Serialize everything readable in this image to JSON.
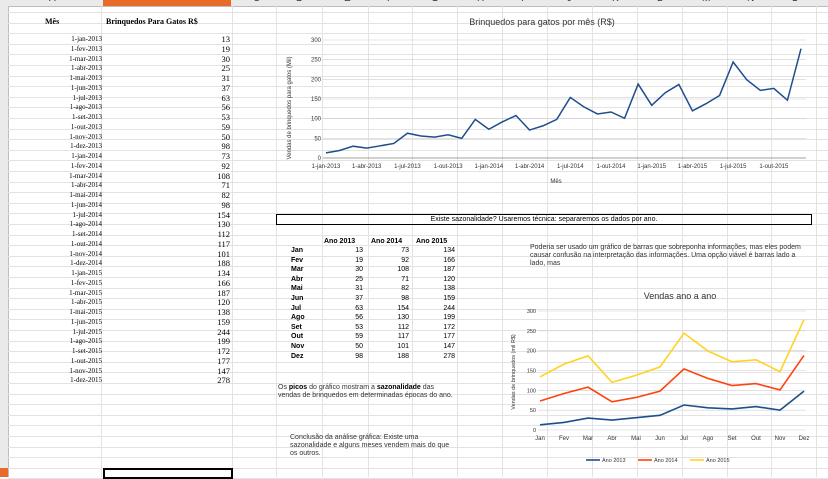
{
  "columns": [
    "A",
    "B",
    "C",
    "D",
    "E",
    "F",
    "G",
    "H",
    "I",
    "J",
    "K",
    "L",
    "M",
    "N",
    "O"
  ],
  "sheet": {
    "header_month": "Mês",
    "header_value": "Brinquedos Para Gatos R$",
    "rows": [
      {
        "date": "1-jan-2013",
        "value": "13"
      },
      {
        "date": "1-fev-2013",
        "value": "19"
      },
      {
        "date": "1-mar-2013",
        "value": "30"
      },
      {
        "date": "1-abr-2013",
        "value": "25"
      },
      {
        "date": "1-mai-2013",
        "value": "31"
      },
      {
        "date": "1-jun-2013",
        "value": "37"
      },
      {
        "date": "1-jul-2013",
        "value": "63"
      },
      {
        "date": "1-ago-2013",
        "value": "56"
      },
      {
        "date": "1-set-2013",
        "value": "53"
      },
      {
        "date": "1-out-2013",
        "value": "59"
      },
      {
        "date": "1-nov-2013",
        "value": "50"
      },
      {
        "date": "1-dez-2013",
        "value": "98"
      },
      {
        "date": "1-jan-2014",
        "value": "73"
      },
      {
        "date": "1-fev-2014",
        "value": "92"
      },
      {
        "date": "1-mar-2014",
        "value": "108"
      },
      {
        "date": "1-abr-2014",
        "value": "71"
      },
      {
        "date": "1-mai-2014",
        "value": "82"
      },
      {
        "date": "1-jun-2014",
        "value": "98"
      },
      {
        "date": "1-jul-2014",
        "value": "154"
      },
      {
        "date": "1-ago-2014",
        "value": "130"
      },
      {
        "date": "1-set-2014",
        "value": "112"
      },
      {
        "date": "1-out-2014",
        "value": "117"
      },
      {
        "date": "1-nov-2014",
        "value": "101"
      },
      {
        "date": "1-dez-2014",
        "value": "188"
      },
      {
        "date": "1-jan-2015",
        "value": "134"
      },
      {
        "date": "1-fev-2015",
        "value": "166"
      },
      {
        "date": "1-mar-2015",
        "value": "187"
      },
      {
        "date": "1-abr-2015",
        "value": "120"
      },
      {
        "date": "1-mai-2015",
        "value": "138"
      },
      {
        "date": "1-jun-2015",
        "value": "159"
      },
      {
        "date": "1-jul-2015",
        "value": "244"
      },
      {
        "date": "1-ago-2015",
        "value": "199"
      },
      {
        "date": "1-set-2015",
        "value": "172"
      },
      {
        "date": "1-out-2015",
        "value": "177"
      },
      {
        "date": "1-nov-2015",
        "value": "147"
      },
      {
        "date": "1-dez-2015",
        "value": "278"
      }
    ]
  },
  "seasonality_banner": "Existe sazonalidade? Usaremos técnica: separaremos os dados por ano.",
  "year_table": {
    "headers": [
      "Ano 2013",
      "Ano 2014",
      "Ano 2015"
    ],
    "rows": [
      {
        "m": "Jan",
        "a": "13",
        "b": "73",
        "c": "134"
      },
      {
        "m": "Fev",
        "a": "19",
        "b": "92",
        "c": "166"
      },
      {
        "m": "Mar",
        "a": "30",
        "b": "108",
        "c": "187"
      },
      {
        "m": "Abr",
        "a": "25",
        "b": "71",
        "c": "120"
      },
      {
        "m": "Mai",
        "a": "31",
        "b": "82",
        "c": "138"
      },
      {
        "m": "Jun",
        "a": "37",
        "b": "98",
        "c": "159"
      },
      {
        "m": "Jul",
        "a": "63",
        "b": "154",
        "c": "244"
      },
      {
        "m": "Ago",
        "a": "56",
        "b": "130",
        "c": "199"
      },
      {
        "m": "Set",
        "a": "53",
        "b": "112",
        "c": "172"
      },
      {
        "m": "Out",
        "a": "59",
        "b": "117",
        "c": "177"
      },
      {
        "m": "Nov",
        "a": "50",
        "b": "101",
        "c": "147"
      },
      {
        "m": "Dez",
        "a": "98",
        "b": "188",
        "c": "278"
      }
    ]
  },
  "note_bars": "Poderia ser usado um gráfico de barras que sobreponha informações, mas eles podem causar confusão na interpretação das informações. Uma opção viável é barras lado a lado, mas",
  "note_peaks": {
    "p1": "Os ",
    "b1": "picos",
    "p2": " do gráfico mostram a ",
    "b2": "sazonalidade",
    "p3": " das vendas de brinquedos em determinadas épocas do ano."
  },
  "note_conclusion": "Conclusão da análise gráfica: Existe uma sazonalidade e alguns meses vendem mais do que os outros.",
  "colors": {
    "accent": "#e86b2a",
    "line_main": "#1f4e8c",
    "y2013": "#1f4e8c",
    "y2014": "#ff420e",
    "y2015": "#ffd320"
  },
  "chart_data": [
    {
      "type": "line",
      "title": "Brinquedos para gatos por mês (R$)",
      "xlabel": "Mês",
      "ylabel": "Vendas de brinquedos para gatos (Mil)",
      "ylim": [
        0,
        300
      ],
      "yticks": [
        "0",
        "50",
        "100",
        "150",
        "200",
        "250",
        "300"
      ],
      "xticks": [
        "1-jan-2013",
        "1-abr-2013",
        "1-jul-2013",
        "1-out-2013",
        "1-jan-2014",
        "1-abr-2014",
        "1-jul-2014",
        "1-out-2014",
        "1-jan-2015",
        "1-abr-2015",
        "1-jul-2015",
        "1-out-2015"
      ],
      "values": [
        13,
        19,
        30,
        25,
        31,
        37,
        63,
        56,
        53,
        59,
        50,
        98,
        73,
        92,
        108,
        71,
        82,
        98,
        154,
        130,
        112,
        117,
        101,
        188,
        134,
        166,
        187,
        120,
        138,
        159,
        244,
        199,
        172,
        177,
        147,
        278
      ]
    },
    {
      "type": "line",
      "title": "Vendas ano a ano",
      "ylabel": "Vendas de brinquedos (mil R$)",
      "ylim": [
        0,
        300
      ],
      "yticks": [
        "0",
        "50",
        "100",
        "150",
        "200",
        "250",
        "300"
      ],
      "categories": [
        "Jan",
        "Fev",
        "Mar",
        "Abr",
        "Mai",
        "Jun",
        "Jul",
        "Ago",
        "Set",
        "Out",
        "Nov",
        "Dez"
      ],
      "series": [
        {
          "name": "Ano 2013",
          "values": [
            13,
            19,
            30,
            25,
            31,
            37,
            63,
            56,
            53,
            59,
            50,
            98
          ]
        },
        {
          "name": "Ano 2014",
          "values": [
            73,
            92,
            108,
            71,
            82,
            98,
            154,
            130,
            112,
            117,
            101,
            188
          ]
        },
        {
          "name": "Ano 2015",
          "values": [
            134,
            166,
            187,
            120,
            138,
            159,
            244,
            199,
            172,
            177,
            147,
            278
          ]
        }
      ]
    }
  ]
}
